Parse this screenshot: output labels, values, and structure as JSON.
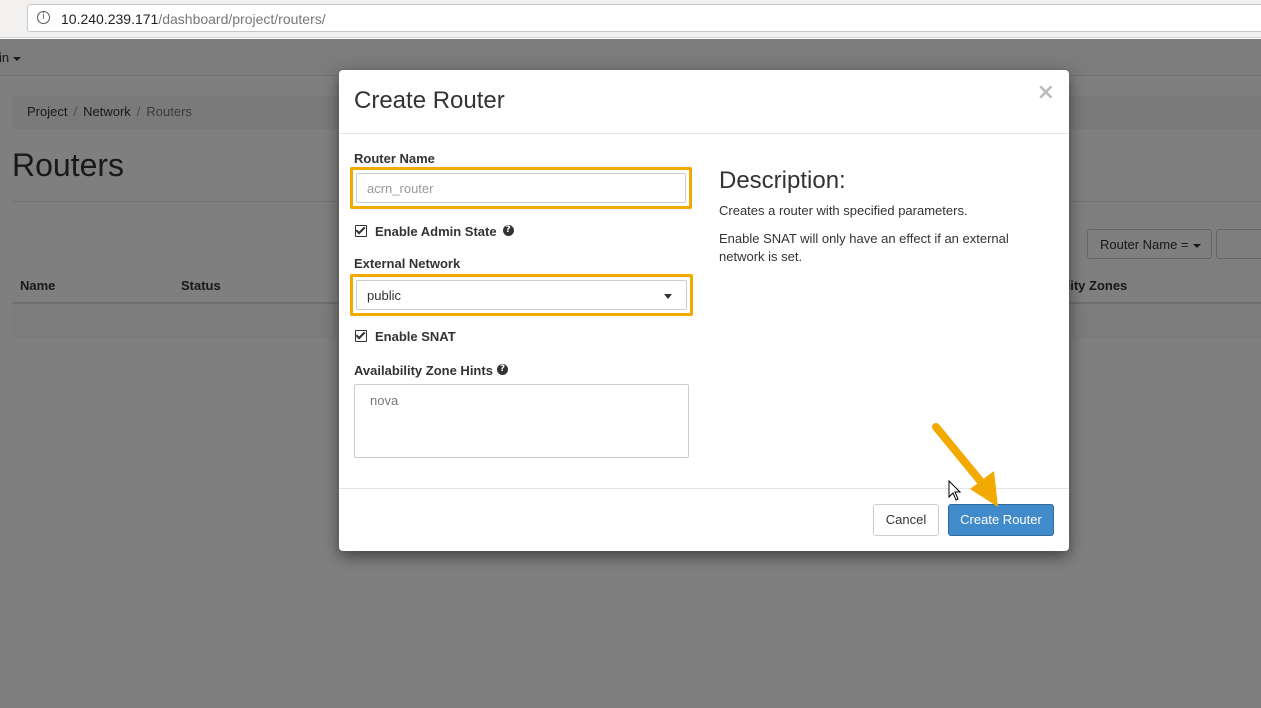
{
  "browser": {
    "url_host": "10.240.239.171",
    "url_path": "/dashboard/project/routers/",
    "info_icon": "info-circle-icon"
  },
  "navbar": {
    "user_label": "in"
  },
  "breadcrumb": {
    "items": [
      "Project",
      "Network",
      "Routers"
    ]
  },
  "page": {
    "title": "Routers",
    "filter_label": "Router Name ="
  },
  "table": {
    "columns": [
      "Name",
      "Status",
      "ility Zones"
    ]
  },
  "modal": {
    "title": "Create Router",
    "close_glyph": "×",
    "router_name_label": "Router Name",
    "router_name_placeholder": "acrn_router",
    "enable_admin_state_label": "Enable Admin State",
    "enable_admin_state_checked": true,
    "external_network_label": "External Network",
    "external_network_value": "public",
    "enable_snat_label": "Enable SNAT",
    "enable_snat_checked": true,
    "availability_zone_label": "Availability Zone Hints",
    "availability_zone_option": "nova",
    "description_title": "Description:",
    "description_line1": "Creates a router with specified parameters.",
    "description_line2": "Enable SNAT will only have an effect if an external network is set.",
    "cancel_label": "Cancel",
    "create_label": "Create Router"
  },
  "colors": {
    "highlight": "#f2a900",
    "primary_button": "#428bca",
    "backdrop": "rgba(0,0,0,0.5)"
  }
}
